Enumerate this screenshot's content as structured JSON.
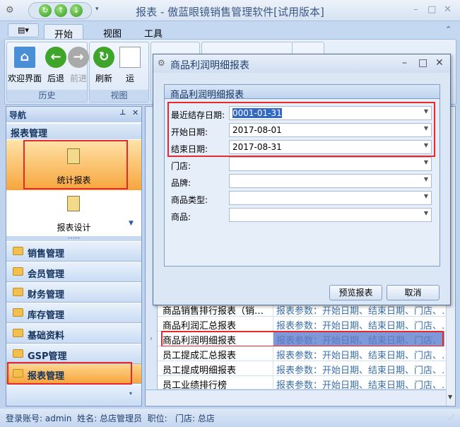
{
  "window": {
    "title": "报表 - 傲蓝眼镜销售管理软件[试用版本]"
  },
  "ribbon": {
    "tabs": [
      {
        "label": "开始",
        "active": true
      },
      {
        "label": "视图"
      },
      {
        "label": "工具"
      }
    ],
    "history": {
      "label": "历史",
      "buttons": [
        "欢迎界面",
        "后退",
        "前进"
      ]
    },
    "view": {
      "label": "视图",
      "buttons": [
        "刷新",
        "运"
      ]
    }
  },
  "nav": {
    "header": "导航",
    "section": "报表管理",
    "items": [
      "统计报表",
      "报表设计"
    ],
    "groups": [
      "销售管理",
      "会员管理",
      "财务管理",
      "库存管理",
      "基础资料",
      "GSP管理",
      "报表管理"
    ],
    "selected_group": "报表管理"
  },
  "grid": {
    "rows": [
      {
        "name": "商品销售排行报表（销…",
        "params": "报表参数：开始日期、结束日期、门店、…"
      },
      {
        "name": "商品利润汇总报表",
        "params": "报表参数：开始日期、结束日期、门店、…"
      },
      {
        "name": "商品利润明细报表",
        "params": "报表参数：开始日期、结束日期、门店、…",
        "selected": true
      },
      {
        "name": "员工提成汇总报表",
        "params": "报表参数：开始日期、结束日期、门店、…"
      },
      {
        "name": "员工提成明细报表",
        "params": "报表参数：开始日期、结束日期、门店、…"
      },
      {
        "name": "员工业绩排行榜",
        "params": "报表参数：开始日期、结束日期、门店、…"
      }
    ]
  },
  "dialog": {
    "title": "商品利润明细报表",
    "group_title": "商品利润明细报表",
    "fields": [
      {
        "label": "最近结存日期:",
        "value": "0001-01-31"
      },
      {
        "label": "开始日期:",
        "value": "2017-08-01"
      },
      {
        "label": "结束日期:",
        "value": "2017-08-31"
      },
      {
        "label": "门店:",
        "value": ""
      },
      {
        "label": "品牌:",
        "value": ""
      },
      {
        "label": "商品类型:",
        "value": ""
      },
      {
        "label": "商品:",
        "value": ""
      }
    ],
    "preview_button": "预览报表",
    "cancel_button": "取消"
  },
  "status": {
    "text": "登录账号: admin  姓名: 总店管理员  职位:   门店: 总店"
  },
  "colors": {
    "highlight": "#e8282f",
    "selected_orange": "#f7a53c",
    "selection_blue": "#7e98d8"
  }
}
